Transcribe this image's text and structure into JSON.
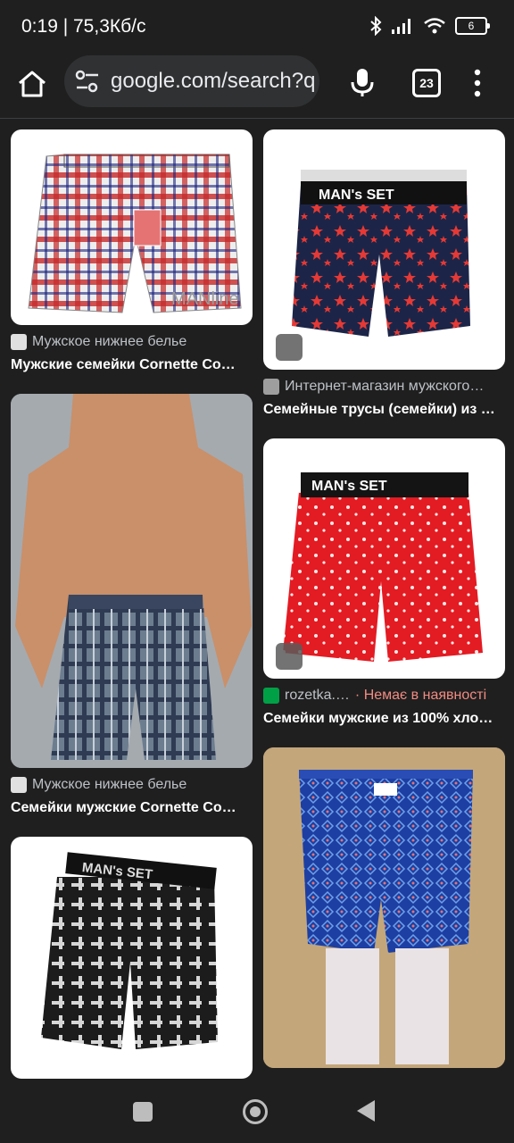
{
  "status_bar": {
    "time_info": "0:19 | 75,3Кб/с",
    "battery": "6"
  },
  "browser": {
    "url": "google.com/search?q",
    "tab_count": "23"
  },
  "results": [
    {
      "source": "Мужское нижнее белье",
      "title": "Мужские семейки Cornette Co…"
    },
    {
      "source": "Интернет-магазин мужского…",
      "title": "Семейные трусы (семейки) из …"
    },
    {
      "source": "Мужское нижнее белье",
      "title": "Семейки мужские Cornette Co…"
    },
    {
      "source": "rozetka.…",
      "stock": "· Немає в наявності",
      "title": "Семейки мужские из 100% хло…"
    }
  ],
  "product_labels": {
    "brand": "MAN's SET",
    "brand_upper": "MAN's SET",
    "watermark": "MANline"
  },
  "colors": {
    "background": "#1f1f1f",
    "out_of_stock": "#f28b82"
  }
}
